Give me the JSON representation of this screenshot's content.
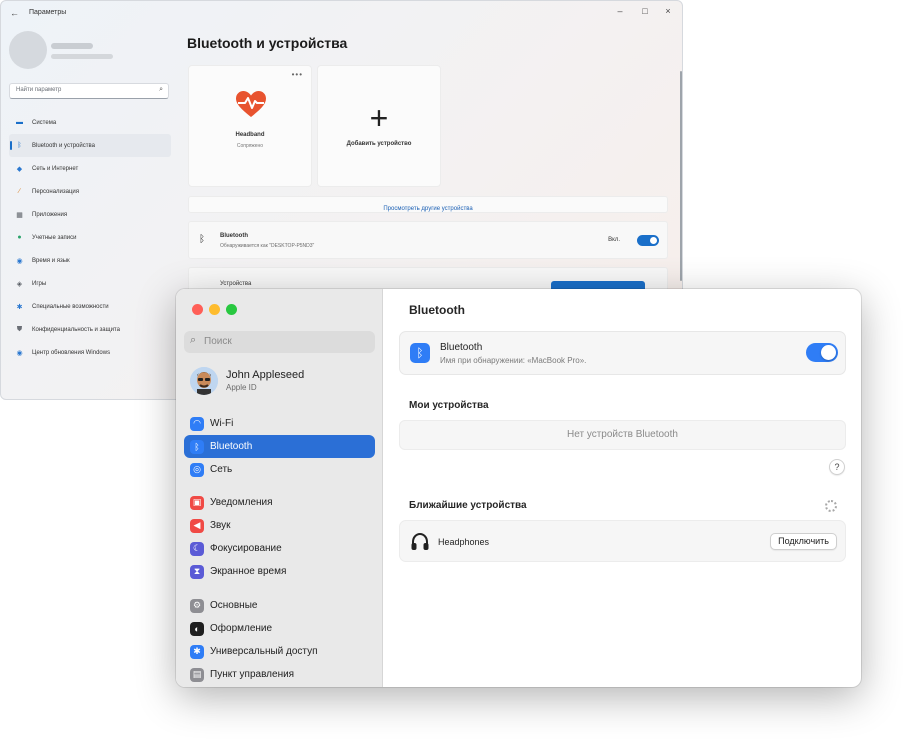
{
  "windows_settings": {
    "title": "Параметры",
    "page_title": "Bluetooth и устройства",
    "search_placeholder": "Найти параметр",
    "nav_items": [
      {
        "label": "Система",
        "icon": "monitor-icon",
        "color": "#1a6fc9"
      },
      {
        "label": "Bluetooth и устройства",
        "icon": "bluetooth-icon",
        "color": "#1a6fc9"
      },
      {
        "label": "Сеть и Интернет",
        "icon": "wifi-icon",
        "color": "#2b78d0"
      },
      {
        "label": "Персонализация",
        "icon": "brush-icon",
        "color": "#d9822b"
      },
      {
        "label": "Приложения",
        "icon": "apps-icon",
        "color": "#555a61"
      },
      {
        "label": "Учетные записи",
        "icon": "person-icon",
        "color": "#2aa36b"
      },
      {
        "label": "Время и язык",
        "icon": "globe-icon",
        "color": "#2b78d0"
      },
      {
        "label": "Игры",
        "icon": "gamepad-icon",
        "color": "#555a61"
      },
      {
        "label": "Специальные возможности",
        "icon": "accessibility-icon",
        "color": "#2b78d0"
      },
      {
        "label": "Конфиденциальность и защита",
        "icon": "shield-icon",
        "color": "#6b6f76"
      },
      {
        "label": "Центр обновления Windows",
        "icon": "update-icon",
        "color": "#2b78d0"
      }
    ],
    "device_card": {
      "name": "Headband",
      "status": "Сопряжено",
      "icon": "heart-pulse-icon",
      "icon_color": "#e8532f"
    },
    "add_card_label": "Добавить устройство",
    "more_devices_link": "Просмотреть другие устройства",
    "bluetooth_row": {
      "title": "Bluetooth",
      "subtitle": "Обнаруживается как \"DESKTOP-P5ND3\"",
      "state": "Вкл."
    },
    "third_row_label": "Устройства",
    "accent_color": "#1a6fc9"
  },
  "mac_settings": {
    "search_placeholder": "Поиск",
    "user": {
      "name": "John Appleseed",
      "subtitle": "Apple ID"
    },
    "nav_groups": [
      [
        {
          "label": "Wi-Fi",
          "icon": "wifi-icon",
          "color": "#2f7df6"
        },
        {
          "label": "Bluetooth",
          "icon": "bluetooth-icon",
          "color": "#2f7df6",
          "active": true
        },
        {
          "label": "Сеть",
          "icon": "globe-icon",
          "color": "#2f7df6"
        }
      ],
      [
        {
          "label": "Уведомления",
          "icon": "bell-icon",
          "color": "#f04a45"
        },
        {
          "label": "Звук",
          "icon": "speaker-icon",
          "color": "#f04a45"
        },
        {
          "label": "Фокусирование",
          "icon": "moon-icon",
          "color": "#5b5bd6"
        },
        {
          "label": "Экранное время",
          "icon": "hourglass-icon",
          "color": "#5b5bd6"
        }
      ],
      [
        {
          "label": "Основные",
          "icon": "gear-icon",
          "color": "#8e8e93"
        },
        {
          "label": "Оформление",
          "icon": "appearance-icon",
          "color": "#1f1f1f"
        },
        {
          "label": "Универсальный доступ",
          "icon": "accessibility-icon",
          "color": "#2f7df6"
        },
        {
          "label": "Пункт управления",
          "icon": "control-center-icon",
          "color": "#8e8e93"
        }
      ]
    ],
    "title": "Bluetooth",
    "bluetooth": {
      "title": "Bluetooth",
      "subtitle": "Имя при обнаружении: «MacBook Pro».",
      "enabled": true
    },
    "my_devices_title": "Мои устройства",
    "no_devices_text": "Нет устройств Bluetooth",
    "help_label": "?",
    "nearby_title": "Ближайшие устройства",
    "nearby_devices": [
      {
        "name": "Headphones",
        "action": "Подключить",
        "icon": "headphones-icon"
      }
    ],
    "accent_color": "#2f7df6",
    "selection_color": "#2b6fd6"
  }
}
